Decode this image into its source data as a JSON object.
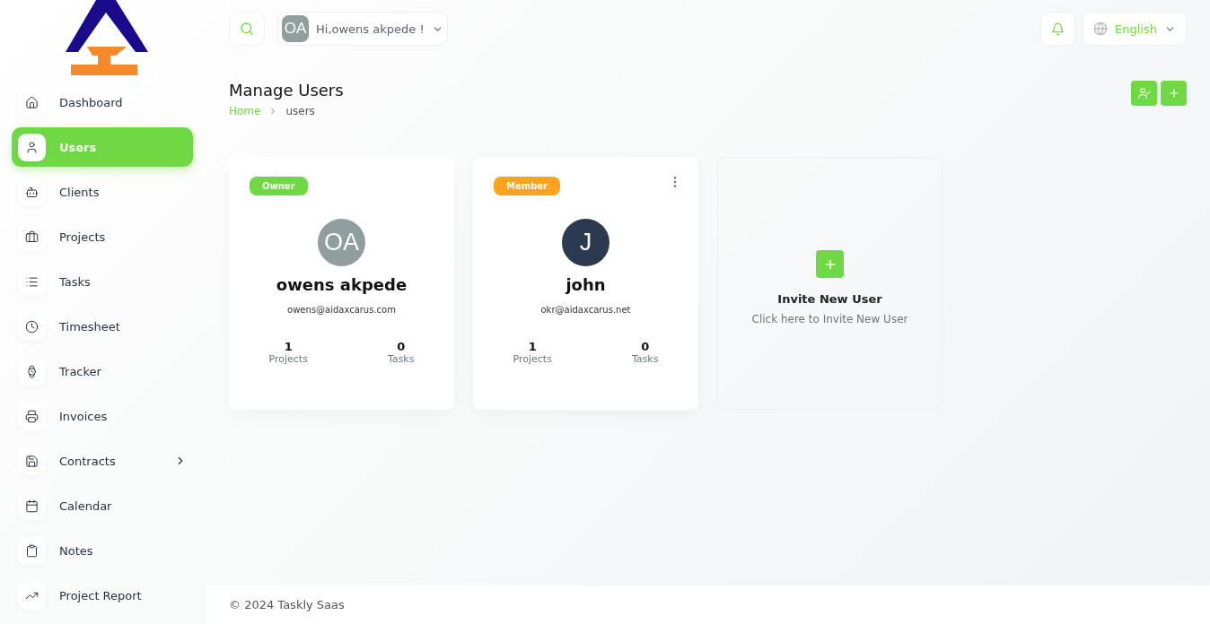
{
  "sidebar": {
    "items": [
      {
        "label": "Dashboard",
        "selected": false,
        "expandable": false
      },
      {
        "label": "Users",
        "selected": true,
        "expandable": false
      },
      {
        "label": "Clients",
        "selected": false,
        "expandable": false
      },
      {
        "label": "Projects",
        "selected": false,
        "expandable": false
      },
      {
        "label": "Tasks",
        "selected": false,
        "expandable": false
      },
      {
        "label": "Timesheet",
        "selected": false,
        "expandable": false
      },
      {
        "label": "Tracker",
        "selected": false,
        "expandable": false
      },
      {
        "label": "Invoices",
        "selected": false,
        "expandable": false
      },
      {
        "label": "Contracts",
        "selected": false,
        "expandable": true
      },
      {
        "label": "Calendar",
        "selected": false,
        "expandable": false
      },
      {
        "label": "Notes",
        "selected": false,
        "expandable": false
      },
      {
        "label": "Project Report",
        "selected": false,
        "expandable": false
      }
    ]
  },
  "topbar": {
    "user": {
      "initials": "OA",
      "greeting": "Hi,owens akpede !"
    },
    "language": "English"
  },
  "page": {
    "title": "Manage Users",
    "breadcrumb": [
      "Home",
      "users"
    ]
  },
  "users": [
    {
      "role": "Owner",
      "color": "#6fd943",
      "initials": "OA",
      "name": "owens akpede",
      "email": "owens@aidaxcarus.com",
      "projects": "1",
      "projects_label": "Projects",
      "tasks": "0",
      "tasks_label": "Tasks",
      "has_menu": false
    },
    {
      "role": "Member",
      "color": "#ffa21d",
      "initials": "J",
      "name": "john",
      "email": "okr@aidaxcarus.net",
      "projects": "1",
      "projects_label": "Projects",
      "tasks": "0",
      "tasks_label": "Tasks",
      "has_menu": true
    }
  ],
  "invite": {
    "title": "Invite New User",
    "subtitle": "Click here to Invite New User"
  },
  "footer": "© 2024 Taskly Saas"
}
